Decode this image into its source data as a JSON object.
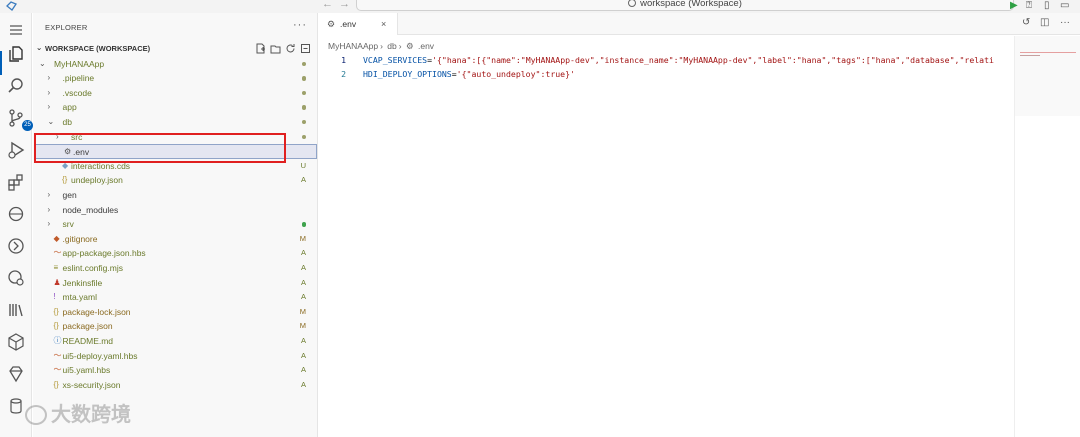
{
  "titlebar": {
    "command_center_text": "workspace (Workspace)",
    "back_glyph": "←",
    "forward_glyph": "→"
  },
  "activitybar": {
    "items": [
      {
        "icon": "menu-icon"
      },
      {
        "icon": "explorer-icon"
      },
      {
        "icon": "search-icon"
      },
      {
        "icon": "source-control-icon",
        "badge": "25"
      },
      {
        "icon": "run-debug-icon"
      },
      {
        "icon": "extensions-icon"
      },
      {
        "icon": "remote-icon"
      },
      {
        "icon": "git-graph-icon"
      },
      {
        "icon": "cloud-foundry-icon"
      },
      {
        "icon": "library-icon"
      },
      {
        "icon": "package-icon"
      },
      {
        "icon": "diamond-icon"
      },
      {
        "icon": "database-icon"
      }
    ]
  },
  "explorer": {
    "header": "EXPLORER",
    "more": "···",
    "workspace_label": "WORKSPACE (WORKSPACE)",
    "tree": [
      {
        "name": "MyHANAApp",
        "kind": "folder",
        "open": true,
        "depth": 0,
        "status": "dot",
        "color": "#6a7a2b"
      },
      {
        "name": ".pipeline",
        "kind": "folder",
        "open": false,
        "depth": 1,
        "status": "dot",
        "color": "#6a7a2b"
      },
      {
        "name": ".vscode",
        "kind": "folder",
        "open": false,
        "depth": 1,
        "status": "dot",
        "color": "#6a7a2b"
      },
      {
        "name": "app",
        "kind": "folder",
        "open": false,
        "depth": 1,
        "status": "dot",
        "color": "#6a7a2b"
      },
      {
        "name": "db",
        "kind": "folder",
        "open": true,
        "depth": 1,
        "status": "dot",
        "color": "#6a7a2b"
      },
      {
        "name": "src",
        "kind": "folder",
        "open": false,
        "depth": 2,
        "status": "dot",
        "color": "#6a7a2b"
      },
      {
        "name": ".env",
        "kind": "file",
        "icon": "gear-icon",
        "depth": 2,
        "status": "",
        "color": "#3b3b3b",
        "selected": true
      },
      {
        "name": "interactions.cds",
        "kind": "file",
        "icon": "cds-icon",
        "depth": 2,
        "status": "U",
        "color": "#6a7a2b"
      },
      {
        "name": "undeploy.json",
        "kind": "file",
        "icon": "json-icon",
        "depth": 2,
        "status": "A",
        "color": "#6a7a2b"
      },
      {
        "name": "gen",
        "kind": "folder",
        "open": false,
        "depth": 1,
        "status": "",
        "color": "#3b3b3b"
      },
      {
        "name": "node_modules",
        "kind": "folder",
        "open": false,
        "depth": 1,
        "status": "",
        "color": "#3b3b3b"
      },
      {
        "name": "srv",
        "kind": "folder",
        "open": false,
        "depth": 1,
        "status": "dot-green",
        "color": "#6a7a2b"
      },
      {
        "name": ".gitignore",
        "kind": "file",
        "icon": "git-icon",
        "depth": 1,
        "status": "M",
        "color": "#8a6a20"
      },
      {
        "name": "app-package.json.hbs",
        "kind": "file",
        "icon": "hbs-icon",
        "depth": 1,
        "status": "A",
        "color": "#6a7a2b"
      },
      {
        "name": "eslint.config.mjs",
        "kind": "file",
        "icon": "js-icon",
        "depth": 1,
        "status": "A",
        "color": "#6a7a2b"
      },
      {
        "name": "Jenkinsfile",
        "kind": "file",
        "icon": "jenkins-icon",
        "depth": 1,
        "status": "A",
        "color": "#6a7a2b"
      },
      {
        "name": "mta.yaml",
        "kind": "file",
        "icon": "yaml-icon",
        "depth": 1,
        "status": "A",
        "color": "#6a7a2b"
      },
      {
        "name": "package-lock.json",
        "kind": "file",
        "icon": "json-icon",
        "depth": 1,
        "status": "M",
        "color": "#8a6a20"
      },
      {
        "name": "package.json",
        "kind": "file",
        "icon": "json-icon",
        "depth": 1,
        "status": "M",
        "color": "#8a6a20"
      },
      {
        "name": "README.md",
        "kind": "file",
        "icon": "info-icon",
        "depth": 1,
        "status": "A",
        "color": "#6a7a2b"
      },
      {
        "name": "ui5-deploy.yaml.hbs",
        "kind": "file",
        "icon": "hbs-icon",
        "depth": 1,
        "status": "A",
        "color": "#6a7a2b"
      },
      {
        "name": "ui5.yaml.hbs",
        "kind": "file",
        "icon": "hbs-icon",
        "depth": 1,
        "status": "A",
        "color": "#6a7a2b"
      },
      {
        "name": "xs-security.json",
        "kind": "file",
        "icon": "json-icon",
        "depth": 1,
        "status": "A",
        "color": "#6a7a2b"
      }
    ]
  },
  "editor": {
    "tab_label": ".env",
    "tab_close": "×",
    "breadcrumb": [
      "MyHANAApp",
      "db",
      ".env"
    ],
    "lines": [
      {
        "num": "1",
        "key": "VCAP_SERVICES",
        "value": "'{\"hana\":[{\"name\":\"MyHANAApp-dev\",\"instance_name\":\"MyHANAApp-dev\",\"label\":\"hana\",\"tags\":[\"hana\",\"database\",\"relati"
      },
      {
        "num": "2",
        "key": "HDI_DEPLOY_OPTIONS",
        "value": "'{\"auto_undeploy\":true}'"
      }
    ]
  },
  "watermark": "大数跨境",
  "colors": {
    "accent": "#005fb8",
    "added": "#6a7a2b",
    "modified": "#8a6a20",
    "highlight_box": "#e02020"
  }
}
